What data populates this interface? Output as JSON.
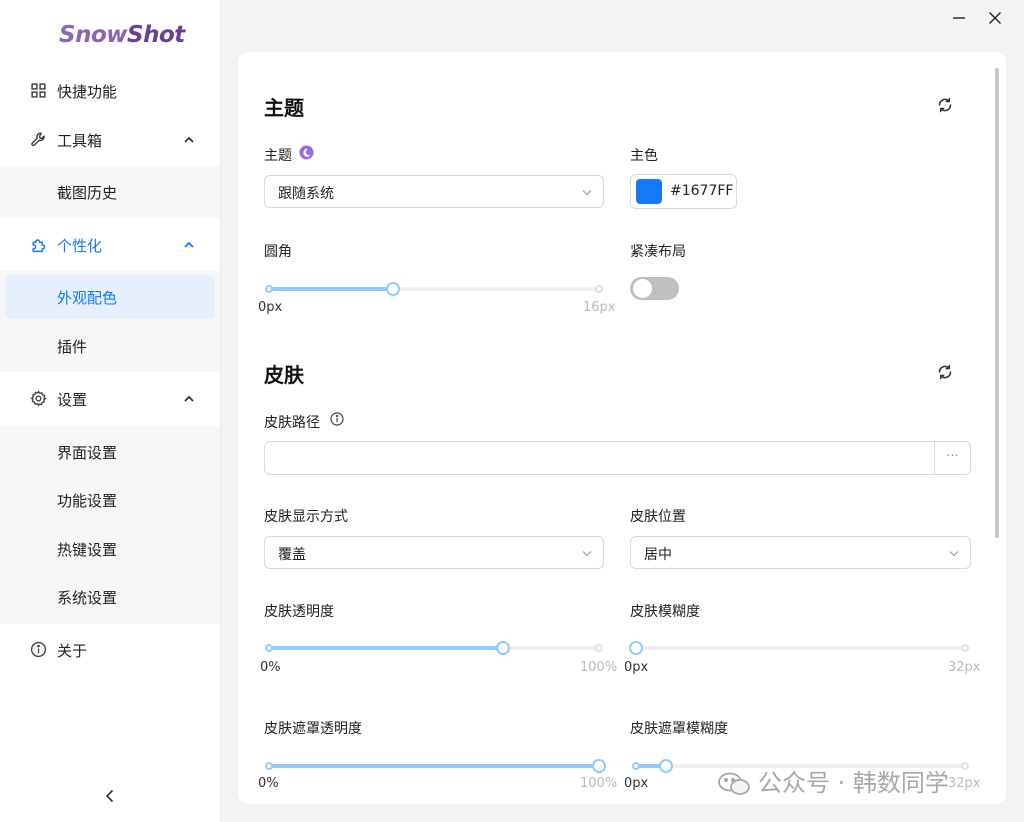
{
  "app": {
    "logo_part1": "Snow",
    "logo_part2": "Shot"
  },
  "sidebar": {
    "quick": "快捷功能",
    "toolbox": "工具箱",
    "toolbox_items": [
      "截图历史"
    ],
    "personalize": "个性化",
    "personalize_items": [
      "外观配色",
      "插件"
    ],
    "settings": "设置",
    "settings_items": [
      "界面设置",
      "功能设置",
      "热键设置",
      "系统设置"
    ],
    "about": "关于"
  },
  "theme": {
    "title": "主题",
    "theme_label": "主题",
    "theme_value": "跟随系统",
    "primary_label": "主色",
    "primary_value": "#1677FF",
    "primary_color": "#1677ff",
    "radius_label": "圆角",
    "radius_min": "0px",
    "radius_max": "16px",
    "radius_value": 6,
    "radius_max_value": 16,
    "compact_label": "紧凑布局",
    "compact_on": false
  },
  "skin": {
    "title": "皮肤",
    "path_label": "皮肤路径",
    "path_value": "",
    "path_button": "···",
    "display_label": "皮肤显示方式",
    "display_value": "覆盖",
    "position_label": "皮肤位置",
    "position_value": "居中",
    "opacity_label": "皮肤透明度",
    "opacity_min": "0%",
    "opacity_max": "100%",
    "opacity_fraction": 0.71,
    "blur_label": "皮肤模糊度",
    "blur_min": "0px",
    "blur_max": "32px",
    "blur_fraction": 0,
    "mask_opacity_label": "皮肤遮罩透明度",
    "mask_opacity_min": "0%",
    "mask_opacity_max": "100%",
    "mask_opacity_fraction": 1.0,
    "mask_blur_label": "皮肤遮罩模糊度",
    "mask_blur_min": "0px",
    "mask_blur_max": "32px",
    "mask_blur_fraction": 0.09
  },
  "watermark": {
    "text": "公众号 · 韩数同学"
  }
}
